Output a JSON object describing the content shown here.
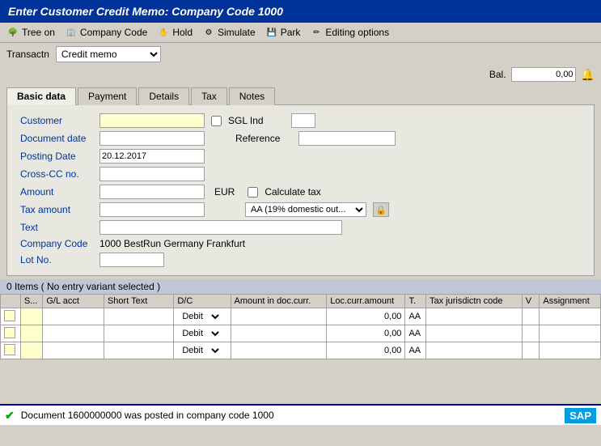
{
  "title": "Enter Customer Credit Memo: Company Code 1000",
  "toolbar": {
    "items": [
      {
        "label": "Tree on",
        "icon": "🌳"
      },
      {
        "label": "Company Code",
        "icon": "🏢"
      },
      {
        "label": "Hold",
        "icon": "✋"
      },
      {
        "label": "Simulate",
        "icon": "⚙"
      },
      {
        "label": "Park",
        "icon": "💾"
      },
      {
        "label": "Editing options",
        "icon": "✏"
      }
    ]
  },
  "transactn": {
    "label": "Transactn",
    "value": "Credit memo"
  },
  "bal": {
    "label": "Bal.",
    "value": "0,00"
  },
  "tabs": [
    {
      "label": "Basic data",
      "active": true
    },
    {
      "label": "Payment"
    },
    {
      "label": "Details"
    },
    {
      "label": "Tax"
    },
    {
      "label": "Notes"
    }
  ],
  "form": {
    "customer_label": "Customer",
    "sgl_ind_label": "SGL Ind",
    "document_date_label": "Document date",
    "reference_label": "Reference",
    "posting_date_label": "Posting Date",
    "posting_date_value": "20.12.2017",
    "cross_cc_label": "Cross-CC no.",
    "amount_label": "Amount",
    "currency": "EUR",
    "calculate_tax_label": "Calculate tax",
    "tax_amount_label": "Tax amount",
    "tax_type": "AA (19% domestic out...",
    "text_label": "Text",
    "company_code_label": "Company Code",
    "company_code_value": "1000 BestRun Germany Frankfurt",
    "lot_no_label": "Lot No."
  },
  "items_section": {
    "header": "0 Items ( No entry variant selected )",
    "columns": [
      "",
      "S...",
      "G/L acct",
      "Short Text",
      "D/C",
      "Amount in doc.curr.",
      "Loc.curr.amount",
      "T.",
      "Tax jurisdictn code",
      "V",
      "Assignment"
    ],
    "rows": [
      {
        "dc": "Debit",
        "loc_amount": "0,00",
        "tax": "AA"
      },
      {
        "dc": "Debit",
        "loc_amount": "0,00",
        "tax": "AA"
      },
      {
        "dc": "Debit",
        "loc_amount": "0,00",
        "tax": "AA"
      }
    ]
  },
  "status": {
    "message": "Document 1600000000 was posted in company code 1000",
    "sap_label": "SAP"
  }
}
